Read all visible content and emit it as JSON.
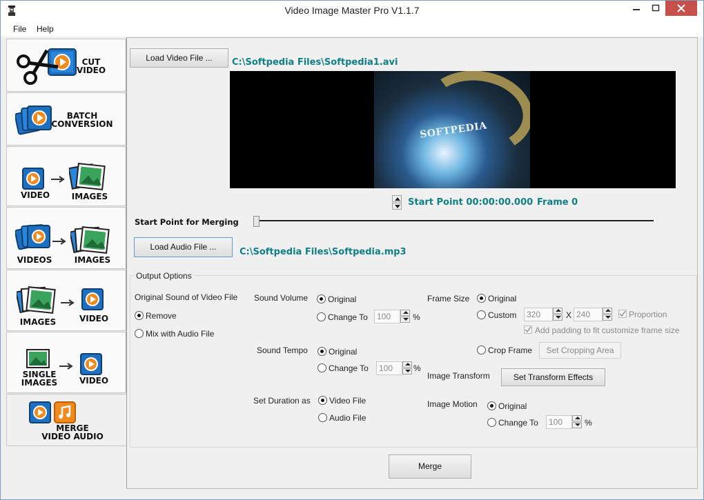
{
  "window": {
    "title": "Video Image Master Pro V1.1.7"
  },
  "menu": {
    "file": "File",
    "help": "Help"
  },
  "sidebar": {
    "tabs": [
      {
        "label1": "CUT",
        "label2": "VIDEO"
      },
      {
        "label1": "BATCH",
        "label2": "CONVERSION"
      },
      {
        "left": "VIDEO",
        "right": "IMAGES"
      },
      {
        "left": "VIDEOS",
        "right": "IMAGES"
      },
      {
        "left": "IMAGES",
        "right": "VIDEO"
      },
      {
        "left1": "SINGLE",
        "left2": "IMAGES",
        "right": "VIDEO"
      },
      {
        "label1": "MERGE",
        "label2": "VIDEO AUDIO"
      }
    ]
  },
  "video": {
    "load_button": "Load Video File ...",
    "path": "C:\\Softpedia Files\\Softpedia1.avi",
    "start_point": "Start Point 00:00:00.000",
    "frame": "Frame 0",
    "watermark": "SOFTPEDIA"
  },
  "merge_start_label": "Start Point for Merging",
  "audio": {
    "load_button": "Load Audio File ...",
    "path": "C:\\Softpedia Files\\Softpedia.mp3"
  },
  "output": {
    "title": "Output Options",
    "original_sound_label": "Original Sound of Video File",
    "remove": "Remove",
    "mix": "Mix with Audio File",
    "sound_volume_label": "Sound Volume",
    "sound_tempo_label": "Sound Tempo",
    "original": "Original",
    "change_to": "Change To",
    "volume_value": "100",
    "tempo_value": "100",
    "percent": "%",
    "set_duration_label": "Set Duration as",
    "video_file": "Video File",
    "audio_file": "Audio File",
    "frame_size_label": "Frame Size",
    "custom": "Custom",
    "width": "320",
    "x": "X",
    "height": "240",
    "proportion": "Proportion",
    "padding": "Add padding to fit customize frame size",
    "crop_frame": "Crop Frame",
    "set_cropping": "Set Cropping Area",
    "image_transform_label": "Image Transform",
    "set_transform": "Set Transform Effects",
    "image_motion_label": "Image Motion",
    "motion_value": "100"
  },
  "merge_button": "Merge",
  "colors": {
    "accent_teal": "#0f7f86",
    "close_red": "#c7504a",
    "icon_blue": "#1f6fbf",
    "icon_orange": "#f08a1c"
  }
}
